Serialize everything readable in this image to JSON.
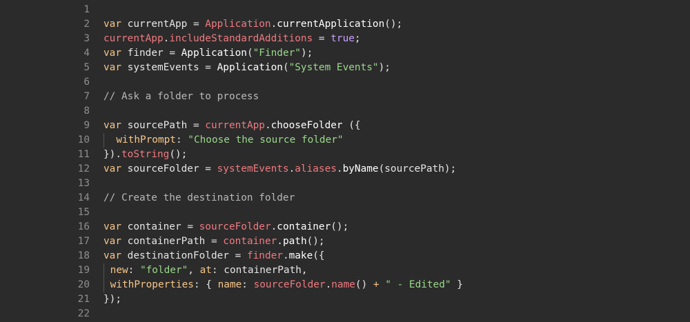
{
  "editor": {
    "lines": [
      {
        "num": "1",
        "tokens": []
      },
      {
        "num": "2",
        "tokens": [
          {
            "t": "var",
            "c": "kw"
          },
          {
            "t": " currentApp ",
            "c": "id"
          },
          {
            "t": "= ",
            "c": "op"
          },
          {
            "t": "Application",
            "c": "pr"
          },
          {
            "t": ".",
            "c": "op"
          },
          {
            "t": "currentApplication",
            "c": "fn"
          },
          {
            "t": "();",
            "c": "op"
          }
        ]
      },
      {
        "num": "3",
        "tokens": [
          {
            "t": "currentApp",
            "c": "pr"
          },
          {
            "t": ".",
            "c": "op"
          },
          {
            "t": "includeStandardAdditions",
            "c": "pr"
          },
          {
            "t": " = ",
            "c": "op"
          },
          {
            "t": "true",
            "c": "bl"
          },
          {
            "t": ";",
            "c": "op"
          }
        ]
      },
      {
        "num": "4",
        "tokens": [
          {
            "t": "var",
            "c": "kw"
          },
          {
            "t": " finder ",
            "c": "id"
          },
          {
            "t": "= ",
            "c": "op"
          },
          {
            "t": "Application",
            "c": "fn"
          },
          {
            "t": "(",
            "c": "op"
          },
          {
            "t": "\"Finder\"",
            "c": "st"
          },
          {
            "t": ");",
            "c": "op"
          }
        ]
      },
      {
        "num": "5",
        "tokens": [
          {
            "t": "var",
            "c": "kw"
          },
          {
            "t": " systemEvents ",
            "c": "id"
          },
          {
            "t": "= ",
            "c": "op"
          },
          {
            "t": "Application",
            "c": "fn"
          },
          {
            "t": "(",
            "c": "op"
          },
          {
            "t": "\"System Events\"",
            "c": "st"
          },
          {
            "t": ");",
            "c": "op"
          }
        ]
      },
      {
        "num": "6",
        "tokens": []
      },
      {
        "num": "7",
        "tokens": [
          {
            "t": "// Ask a folder to process",
            "c": "cm"
          }
        ]
      },
      {
        "num": "8",
        "tokens": []
      },
      {
        "num": "9",
        "tokens": [
          {
            "t": "var",
            "c": "kw"
          },
          {
            "t": " sourcePath ",
            "c": "id"
          },
          {
            "t": "= ",
            "c": "op"
          },
          {
            "t": "currentApp",
            "c": "pr"
          },
          {
            "t": ".",
            "c": "op"
          },
          {
            "t": "chooseFolder",
            "c": "fn"
          },
          {
            "t": " ({",
            "c": "op"
          }
        ]
      },
      {
        "num": "10",
        "guide": true,
        "tokens": [
          {
            "t": "  withPrompt",
            "c": "kw"
          },
          {
            "t": ": ",
            "c": "op"
          },
          {
            "t": "\"Choose the source folder\"",
            "c": "st"
          }
        ]
      },
      {
        "num": "11",
        "tokens": [
          {
            "t": "}).",
            "c": "op"
          },
          {
            "t": "toString",
            "c": "pr"
          },
          {
            "t": "();",
            "c": "op"
          }
        ]
      },
      {
        "num": "12",
        "tokens": [
          {
            "t": "var",
            "c": "kw"
          },
          {
            "t": " sourceFolder ",
            "c": "id"
          },
          {
            "t": "= ",
            "c": "op"
          },
          {
            "t": "systemEvents",
            "c": "pr"
          },
          {
            "t": ".",
            "c": "op"
          },
          {
            "t": "aliases",
            "c": "pr"
          },
          {
            "t": ".",
            "c": "op"
          },
          {
            "t": "byName",
            "c": "fn"
          },
          {
            "t": "(sourcePath);",
            "c": "op"
          }
        ]
      },
      {
        "num": "13",
        "tokens": []
      },
      {
        "num": "14",
        "tokens": [
          {
            "t": "// Create the destination folder",
            "c": "cm"
          }
        ]
      },
      {
        "num": "15",
        "tokens": []
      },
      {
        "num": "16",
        "tokens": [
          {
            "t": "var",
            "c": "kw"
          },
          {
            "t": " container ",
            "c": "id"
          },
          {
            "t": "= ",
            "c": "op"
          },
          {
            "t": "sourceFolder",
            "c": "pr"
          },
          {
            "t": ".",
            "c": "op"
          },
          {
            "t": "container",
            "c": "fn"
          },
          {
            "t": "();",
            "c": "op"
          }
        ]
      },
      {
        "num": "17",
        "tokens": [
          {
            "t": "var",
            "c": "kw"
          },
          {
            "t": " containerPath ",
            "c": "id"
          },
          {
            "t": "= ",
            "c": "op"
          },
          {
            "t": "container",
            "c": "pr"
          },
          {
            "t": ".",
            "c": "op"
          },
          {
            "t": "path",
            "c": "fn"
          },
          {
            "t": "();",
            "c": "op"
          }
        ]
      },
      {
        "num": "18",
        "tokens": [
          {
            "t": "var",
            "c": "kw"
          },
          {
            "t": " destinationFolder ",
            "c": "id"
          },
          {
            "t": "= ",
            "c": "op"
          },
          {
            "t": "finder",
            "c": "pr"
          },
          {
            "t": ".",
            "c": "op"
          },
          {
            "t": "make",
            "c": "fn"
          },
          {
            "t": "({",
            "c": "op"
          }
        ]
      },
      {
        "num": "19",
        "guide": true,
        "tokens": [
          {
            "t": " new",
            "c": "kw"
          },
          {
            "t": ": ",
            "c": "op"
          },
          {
            "t": "\"folder\"",
            "c": "st"
          },
          {
            "t": ", ",
            "c": "op"
          },
          {
            "t": "at",
            "c": "kw"
          },
          {
            "t": ": containerPath,",
            "c": "op"
          }
        ]
      },
      {
        "num": "20",
        "guide": true,
        "tokens": [
          {
            "t": " withProperties",
            "c": "kw"
          },
          {
            "t": ": { ",
            "c": "op"
          },
          {
            "t": "name",
            "c": "kw"
          },
          {
            "t": ": ",
            "c": "op"
          },
          {
            "t": "sourceFolder",
            "c": "pr"
          },
          {
            "t": ".",
            "c": "op"
          },
          {
            "t": "name",
            "c": "pr"
          },
          {
            "t": "() ",
            "c": "op"
          },
          {
            "t": "+",
            "c": "kw"
          },
          {
            "t": " ",
            "c": "op"
          },
          {
            "t": "\" - Edited\"",
            "c": "st"
          },
          {
            "t": " }",
            "c": "op"
          }
        ]
      },
      {
        "num": "21",
        "tokens": [
          {
            "t": "});",
            "c": "op"
          }
        ]
      },
      {
        "num": "22",
        "tokens": []
      }
    ]
  }
}
